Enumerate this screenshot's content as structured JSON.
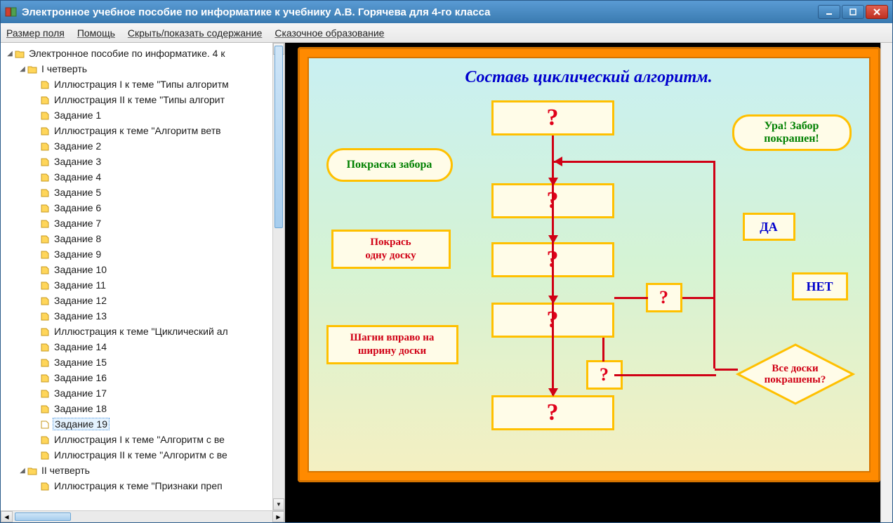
{
  "window": {
    "title": "Электронное учебное пособие по информатике к учебнику А.В. Горячева для 4-го класса"
  },
  "menu": {
    "items": [
      "Размер поля",
      "Помощь",
      "Скрыть/показать содержание",
      "Сказочное образование"
    ]
  },
  "tree": {
    "root": {
      "label": "Электронное пособие по информатике. 4 к",
      "expanded": true
    },
    "q1": {
      "label": "I четверть",
      "expanded": true
    },
    "q2": {
      "label": "II четверть",
      "expanded": true
    },
    "items": [
      "Иллюстрация I к теме \"Типы алгоритм",
      "Иллюстрация II к теме \"Типы алгорит",
      "Задание 1",
      "Иллюстрация к теме \"Алгоритм ветв",
      "Задание 2",
      "Задание 3",
      "Задание 4",
      "Задание 5",
      "Задание 6",
      "Задание 7",
      "Задание 8",
      "Задание 9",
      "Задание 10",
      "Задание 11",
      "Задание 12",
      "Задание 13",
      "Иллюстрация к теме \"Циклический ал",
      "Задание 14",
      "Задание 15",
      "Задание 16",
      "Задание 17",
      "Задание 18",
      "Задание 19",
      "Иллюстрация I к теме \"Алгоритм с ве",
      "Иллюстрация II к теме \"Алгоритм с ве"
    ],
    "q2_first": "Иллюстрация к теме \"Признаки преп",
    "selected_index": 22
  },
  "slide": {
    "title": "Составь циклический алгоритм.",
    "pill_left": "Покраска забора",
    "pill_right_line1": "Ура! Забор",
    "pill_right_line2": "покрашен!",
    "hint1_line1": "Покрась",
    "hint1_line2": "одну доску",
    "hint2_line1": "Шагни вправо на",
    "hint2_line2": "ширину доски",
    "yes": "ДА",
    "no": "НЕТ",
    "diamond_line1": "Все доски",
    "diamond_line2": "покрашены?",
    "qmark": "?"
  }
}
